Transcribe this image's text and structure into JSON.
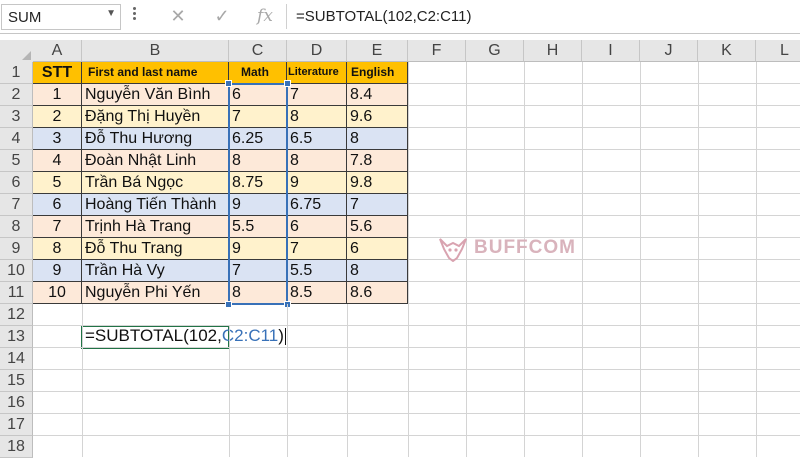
{
  "formula_bar": {
    "name_box": "SUM",
    "formula": "=SUBTOTAL(102,C2:C11)",
    "cancel_icon": "✕",
    "enter_icon": "✓",
    "fx_icon": "fx"
  },
  "sheet": {
    "columns": [
      "A",
      "B",
      "C",
      "D",
      "E",
      "F",
      "G",
      "H",
      "I",
      "J",
      "K",
      "L"
    ],
    "rows": [
      "1",
      "2",
      "3",
      "4",
      "5",
      "6",
      "7",
      "8",
      "9",
      "10",
      "11",
      "12",
      "13",
      "14",
      "15",
      "16",
      "17",
      "18"
    ],
    "header": {
      "stt": "STT",
      "name": "First and last name",
      "math": "Math",
      "literature": "Literature",
      "english": "English"
    },
    "students": [
      {
        "stt": "1",
        "name": "Nguyễn Văn Bình",
        "math": "6",
        "literature": "7",
        "english": "8.4"
      },
      {
        "stt": "2",
        "name": "Đặng Thị Huyền",
        "math": "7",
        "literature": "8",
        "english": "9.6"
      },
      {
        "stt": "3",
        "name": "Đỗ Thu Hương",
        "math": "6.25",
        "literature": "6.5",
        "english": "8"
      },
      {
        "stt": "4",
        "name": "Đoàn Nhật Linh",
        "math": "8",
        "literature": "8",
        "english": "7.8"
      },
      {
        "stt": "5",
        "name": "Trần Bá Ngọc",
        "math": "8.75",
        "literature": "9",
        "english": "9.8"
      },
      {
        "stt": "6",
        "name": "Hoàng Tiến Thành",
        "math": "9",
        "literature": "6.75",
        "english": "7"
      },
      {
        "stt": "7",
        "name": "Trịnh Hà Trang",
        "math": "5.5",
        "literature": "6",
        "english": "5.6"
      },
      {
        "stt": "8",
        "name": "Đỗ Thu Trang",
        "math": "9",
        "literature": "7",
        "english": "6"
      },
      {
        "stt": "9",
        "name": "Trần Hà Vy",
        "math": "7",
        "literature": "5.5",
        "english": "8"
      },
      {
        "stt": "10",
        "name": "Nguyễn Phi Yến",
        "math": "8",
        "literature": "8.5",
        "english": "8.6"
      }
    ],
    "active_cell": {
      "prefix": "=SUBTOTAL(102,",
      "ref": "C2:C11",
      "suffix": ")"
    },
    "watermark": "BUFFCOM"
  },
  "colors": {
    "header_fill": "#ffc000",
    "band_peach": "#fde9d9",
    "band_yellow": "#fff2cc",
    "band_blue": "#dae3f3",
    "excel_green": "#217346",
    "range_blue": "#3871b8"
  }
}
